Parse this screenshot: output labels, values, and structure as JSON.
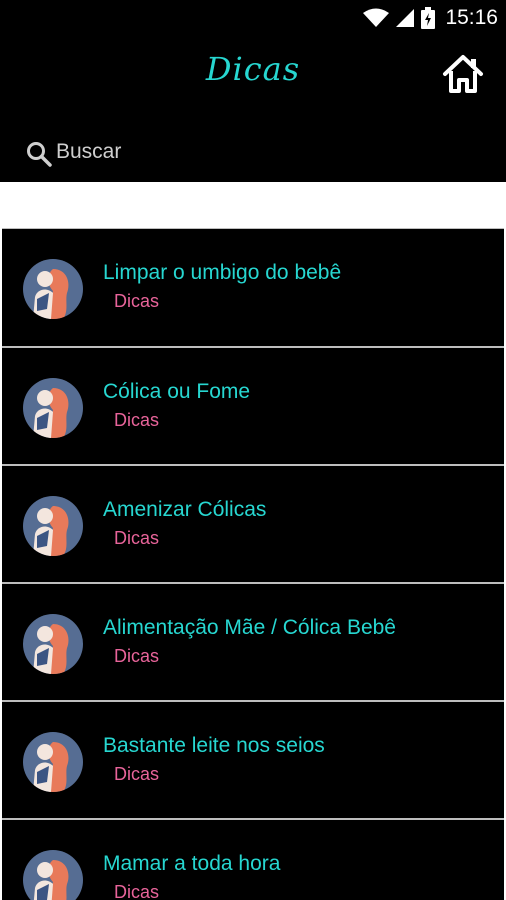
{
  "status_bar": {
    "time": "15:16"
  },
  "app_bar": {
    "title": "Dicas"
  },
  "search": {
    "placeholder": "Buscar"
  },
  "items": [
    {
      "title": "Limpar o umbigo do bebê",
      "category": "Dicas"
    },
    {
      "title": "Cólica ou Fome",
      "category": "Dicas"
    },
    {
      "title": "Amenizar Cólicas",
      "category": "Dicas"
    },
    {
      "title": "Alimentação Mãe / Cólica Bebê",
      "category": "Dicas"
    },
    {
      "title": "Bastante leite nos seios",
      "category": "Dicas"
    },
    {
      "title": "Mamar a toda hora",
      "category": "Dicas"
    }
  ],
  "colors": {
    "accent": "#27d7d1",
    "category": "#e8649a",
    "background": "#000000",
    "avatar_bg": "#566d93"
  }
}
